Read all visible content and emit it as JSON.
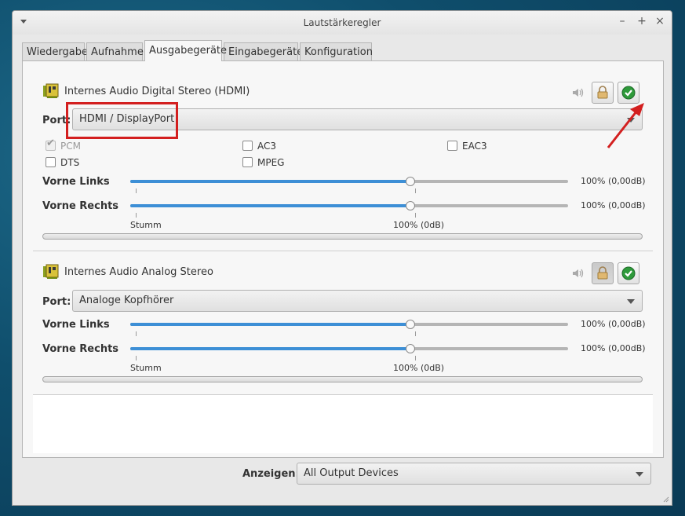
{
  "window": {
    "title": "Lautstärkeregler"
  },
  "tabs": [
    {
      "label": "Wiedergabe",
      "active": false
    },
    {
      "label": "Aufnahme",
      "active": false
    },
    {
      "label": "Ausgabegeräte",
      "active": true
    },
    {
      "label": "Eingabegeräte",
      "active": false
    },
    {
      "label": "Konfiguration",
      "active": false
    }
  ],
  "devices": [
    {
      "name": "Internes Audio Digital Stereo (HDMI)",
      "port_label": "Port:",
      "port_value": "HDMI / DisplayPort",
      "lock_pressed": false,
      "formats": [
        {
          "label": "PCM",
          "checked": true,
          "disabled": true
        },
        {
          "label": "AC3",
          "checked": false,
          "disabled": false
        },
        {
          "label": "EAC3",
          "checked": false,
          "disabled": false
        },
        {
          "label": "DTS",
          "checked": false,
          "disabled": false
        },
        {
          "label": "MPEG",
          "checked": false,
          "disabled": false
        }
      ],
      "channels": [
        {
          "label": "Vorne Links",
          "percent": 100,
          "value_text": "100% (0,00dB)"
        },
        {
          "label": "Vorne Rechts",
          "percent": 100,
          "value_text": "100% (0,00dB)"
        }
      ],
      "scale": {
        "min": "Stumm",
        "norm": "100% (0dB)"
      }
    },
    {
      "name": "Internes Audio Analog Stereo",
      "port_label": "Port:",
      "port_value": "Analoge Kopfhörer",
      "lock_pressed": true,
      "channels": [
        {
          "label": "Vorne Links",
          "percent": 100,
          "value_text": "100% (0,00dB)"
        },
        {
          "label": "Vorne Rechts",
          "percent": 100,
          "value_text": "100% (0,00dB)"
        }
      ],
      "scale": {
        "min": "Stumm",
        "norm": "100% (0dB)"
      }
    }
  ],
  "footer": {
    "show_label": "Anzeigen:",
    "show_value": "All Output Devices"
  },
  "colors": {
    "accent": "#3d8fd6",
    "highlight": "#d31f1f",
    "ok_green": "#2e9a3a"
  },
  "icons": {
    "device": "sound-card-icon",
    "speaker": "speaker-icon",
    "lock": "lock-icon",
    "default": "check-default-icon"
  }
}
